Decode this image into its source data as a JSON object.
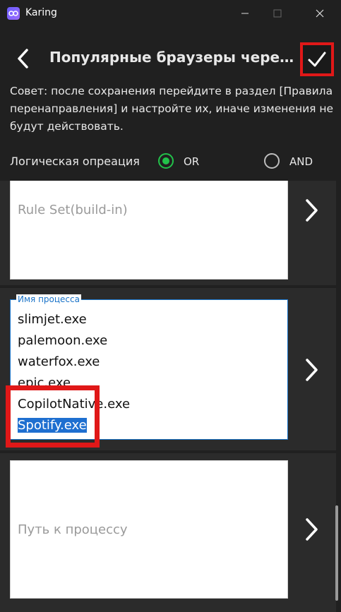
{
  "window": {
    "title": "Karing",
    "controls": [
      "minimize",
      "maximize",
      "close"
    ]
  },
  "header": {
    "title": "Популярные браузеры через ...",
    "back_icon": "chevron-left-icon",
    "confirm_icon": "checkmark-icon"
  },
  "tip": "Совет: после сохранения перейдите в раздел [Правила перенаправления] и настройте их, иначе изменения не будут действовать.",
  "logic": {
    "label": "Логическая опреация",
    "options": [
      {
        "label": "OR",
        "selected": true
      },
      {
        "label": "AND",
        "selected": false
      }
    ],
    "selected_color": "#22c24a"
  },
  "cards": {
    "rule_set": {
      "placeholder": "Rule Set(build-in)"
    },
    "process_name": {
      "legend": "Имя процесса",
      "items": [
        "slimjet.exe",
        "palemoon.exe",
        "waterfox.exe",
        "epic.exe",
        "CopilotNative.exe",
        "Spotify.exe"
      ],
      "selected_item": "Spotify.exe"
    },
    "process_path": {
      "placeholder": "Путь к процессу"
    }
  },
  "colors": {
    "background": "#202020",
    "accent_blue": "#1a73c8",
    "highlight_red": "#e01818"
  }
}
